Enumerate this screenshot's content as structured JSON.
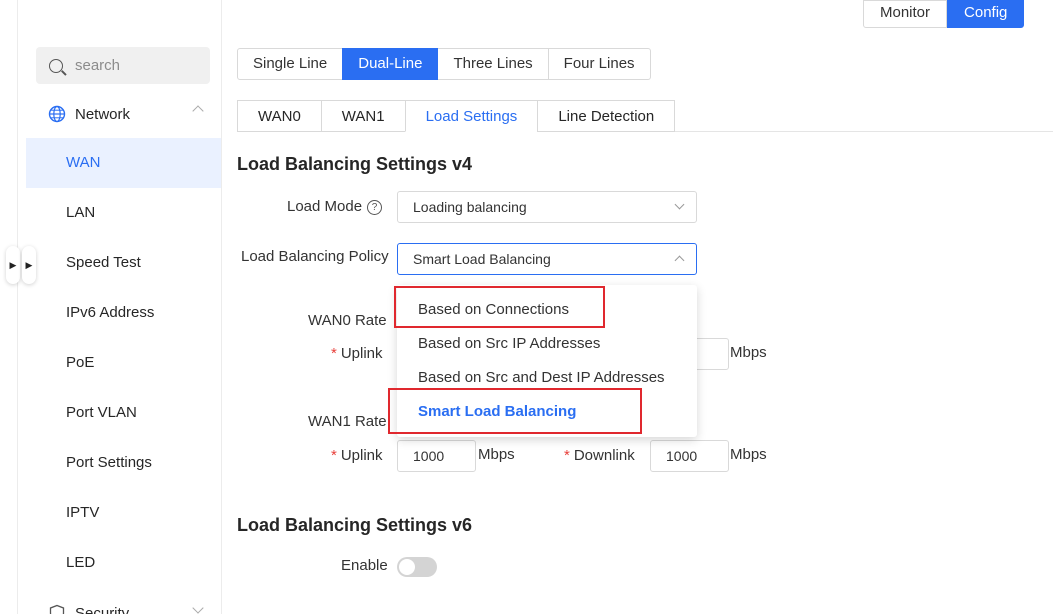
{
  "top_actions": {
    "monitor": "Monitor",
    "config": "Config"
  },
  "sidebar": {
    "search_placeholder": "search",
    "group": "Network",
    "items": [
      {
        "label": "WAN",
        "active": true
      },
      {
        "label": "LAN"
      },
      {
        "label": "Speed Test"
      },
      {
        "label": "IPv6 Address"
      },
      {
        "label": "PoE"
      },
      {
        "label": "Port VLAN"
      },
      {
        "label": "Port Settings"
      },
      {
        "label": "IPTV"
      },
      {
        "label": "LED"
      }
    ],
    "security": "Security"
  },
  "line_modes": [
    "Single Line",
    "Dual-Line",
    "Three Lines",
    "Four Lines"
  ],
  "tabs": [
    "WAN0",
    "WAN1",
    "Load Settings",
    "Line Detection"
  ],
  "v4": {
    "title": "Load Balancing Settings v4",
    "load_mode_label": "Load Mode",
    "load_mode_value": "Loading balancing",
    "policy_label": "Load Balancing Policy",
    "policy_value": "Smart Load Balancing",
    "wan0_rate_label": "WAN0 Rate",
    "wan1_rate_label": "WAN1 Rate",
    "required_mark": "*",
    "uplink_label": "Uplink",
    "downlink_label": "Downlink",
    "unit": "Mbps",
    "wan1_uplink": "1000",
    "wan1_downlink": "1000"
  },
  "policy_options": [
    "Based on Connections",
    "Based on Src IP Addresses",
    "Based on Src and Dest IP Addresses",
    "Smart Load Balancing"
  ],
  "v6": {
    "title": "Load Balancing Settings v6",
    "enable_label": "Enable",
    "enabled": false
  },
  "colors": {
    "accent": "#2a6ef2",
    "highlight_box": "#e0282e",
    "required": "#e8403b"
  }
}
